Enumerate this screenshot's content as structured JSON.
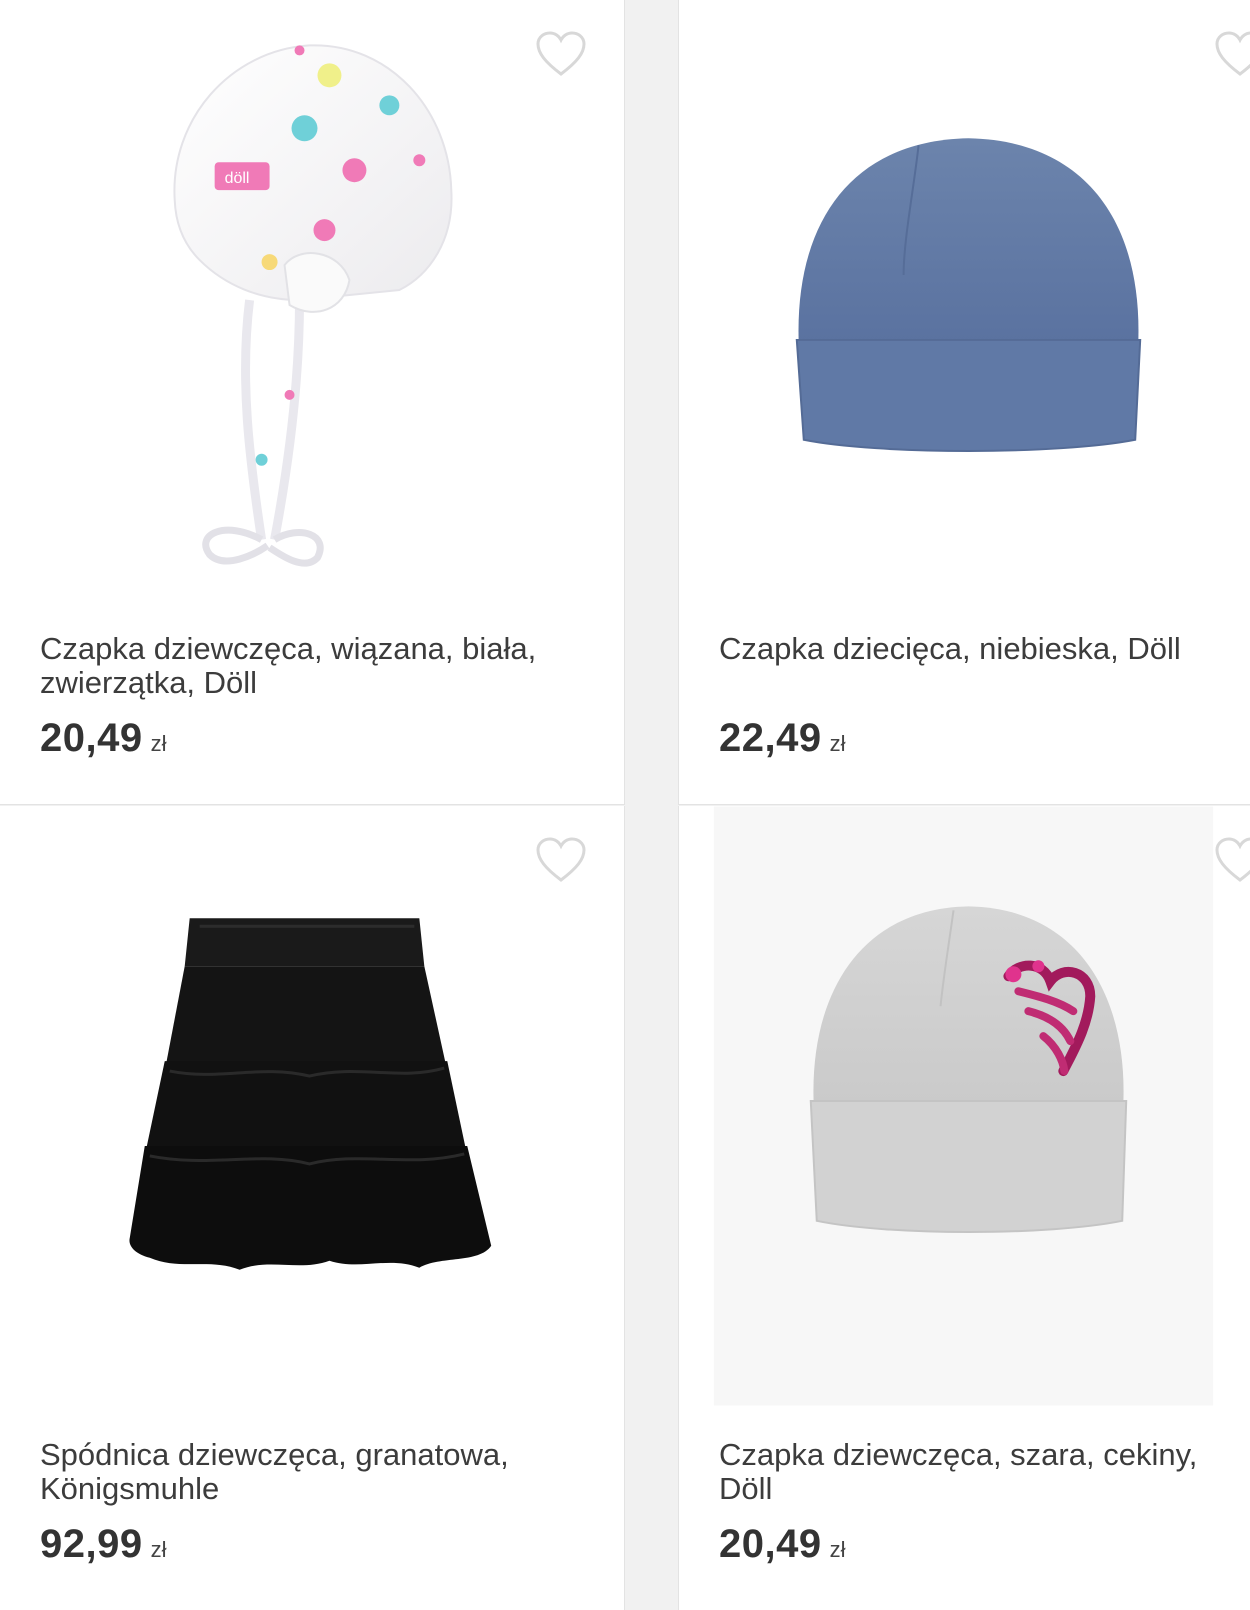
{
  "products": [
    {
      "title": "Czapka dziewczęca, wiązana, biała, zwierzątka, Döll",
      "price": "20,49",
      "currency": "zł",
      "image": "white-baby-bonnet-with-ties"
    },
    {
      "title": "Czapka dziecięca, niebieska, Döll",
      "price": "22,49",
      "currency": "zł",
      "image": "blue-beanie"
    },
    {
      "title": "Spódnica dziewczęca, granatowa, Königsmuhle",
      "price": "92,99",
      "currency": "zł",
      "image": "black-tiered-tulle-skirt"
    },
    {
      "title": "Czapka dziewczęca, szara, cekiny, Döll",
      "price": "20,49",
      "currency": "zł",
      "image": "grey-beanie-with-sequin-heart"
    }
  ],
  "icons": {
    "favorite": "heart-outline-icon"
  },
  "colors": {
    "icon_outline": "#d8d8d8",
    "text": "#3c3c3c",
    "price": "#333333"
  }
}
